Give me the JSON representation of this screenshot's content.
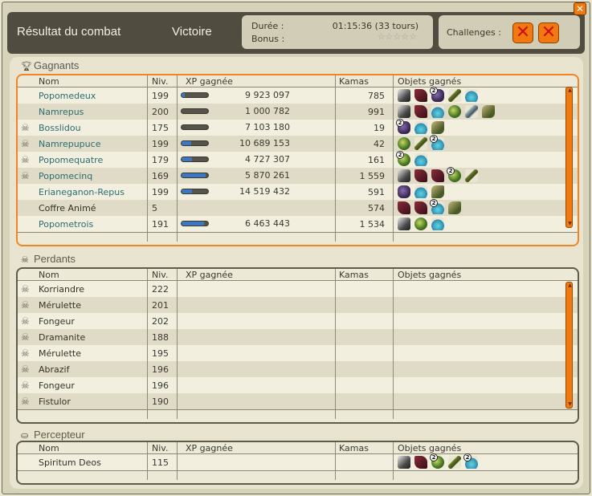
{
  "header": {
    "title": "Résultat du combat",
    "result": "Victoire",
    "duration_label": "Durée :",
    "duration_value": "01:15:36 (33 tours)",
    "bonus_label": "Bonus :",
    "bonus_stars": "☆☆☆☆☆",
    "challenges_label": "Challenges :",
    "challenge_icons": [
      "failed-challenge-icon",
      "failed-challenge-icon"
    ],
    "close_label": "✕"
  },
  "columns": {
    "name": "Nom",
    "level": "Niv.",
    "xp": "XP gagnée",
    "kamas": "Kamas",
    "items": "Objets gagnés"
  },
  "winners": {
    "label": "Gagnants",
    "icon": "trophy-icon",
    "rows": [
      {
        "name": "Popomedeux",
        "level": "199",
        "xp": "9 923 097",
        "xp_fill": 0.12,
        "kamas": "785",
        "dead": false,
        "link": true,
        "items": [
          "weapon",
          "boot",
          "stone:2",
          "wand",
          "potion"
        ]
      },
      {
        "name": "Namrepus",
        "level": "200",
        "xp": "1 000 782",
        "xp_fill": 0.0,
        "kamas": "991",
        "dead": false,
        "link": true,
        "items": [
          "weapon",
          "boot",
          "potion",
          "orb",
          "key",
          "bread"
        ]
      },
      {
        "name": "Bosslidou",
        "level": "175",
        "xp": "7 103 180",
        "xp_fill": 0.0,
        "kamas": "19",
        "dead": true,
        "link": true,
        "items": [
          "stone:2",
          "potion",
          "bread"
        ]
      },
      {
        "name": "Namrepupuce",
        "level": "199",
        "xp": "10 689 153",
        "xp_fill": 0.35,
        "kamas": "42",
        "dead": true,
        "link": true,
        "items": [
          "orb",
          "wand",
          "potion:2"
        ]
      },
      {
        "name": "Popomequatre",
        "level": "179",
        "xp": "4 727 307",
        "xp_fill": 0.4,
        "kamas": "161",
        "dead": true,
        "link": true,
        "items": [
          "orb:2",
          "potion"
        ]
      },
      {
        "name": "Popomecinq",
        "level": "169",
        "xp": "5 870 261",
        "xp_fill": 0.9,
        "kamas": "1 559",
        "dead": true,
        "link": true,
        "items": [
          "weapon",
          "boot",
          "boot",
          "orb:2",
          "wand"
        ]
      },
      {
        "name": "Erianeganon-Repus",
        "level": "199",
        "xp": "14 519 432",
        "xp_fill": 0.4,
        "kamas": "591",
        "dead": false,
        "link": true,
        "items": [
          "stone",
          "potion",
          "bread"
        ]
      },
      {
        "name": "Coffre Animé",
        "level": "5",
        "xp": "",
        "xp_fill": null,
        "kamas": "574",
        "dead": false,
        "link": false,
        "items": [
          "boot",
          "boot",
          "potion:2",
          "bread"
        ]
      },
      {
        "name": "Popometrois",
        "level": "191",
        "xp": "6 463 443",
        "xp_fill": 0.85,
        "kamas": "1 534",
        "dead": false,
        "link": true,
        "items": [
          "weapon",
          "orb",
          "potion"
        ]
      }
    ]
  },
  "losers": {
    "label": "Perdants",
    "icon": "skull-crossbones-icon",
    "rows": [
      {
        "name": "Korriandre",
        "level": "222"
      },
      {
        "name": "Mérulette",
        "level": "201"
      },
      {
        "name": "Fongeur",
        "level": "202"
      },
      {
        "name": "Dramanite",
        "level": "188"
      },
      {
        "name": "Mérulette",
        "level": "195"
      },
      {
        "name": "Abrazif",
        "level": "196"
      },
      {
        "name": "Fongeur",
        "level": "196"
      },
      {
        "name": "Fistulor",
        "level": "190"
      }
    ]
  },
  "collector": {
    "label": "Percepteur",
    "icon": "bag-icon",
    "rows": [
      {
        "name": "Spiritum Deos",
        "level": "115",
        "items": [
          "weapon",
          "boot",
          "orb:2",
          "wand",
          "potion:2"
        ]
      }
    ]
  },
  "colors": {
    "accent_orange": "#f18423",
    "header_bg": "#514c40",
    "xp_bar": "#3d77c2",
    "name_link": "#2a6d72"
  }
}
